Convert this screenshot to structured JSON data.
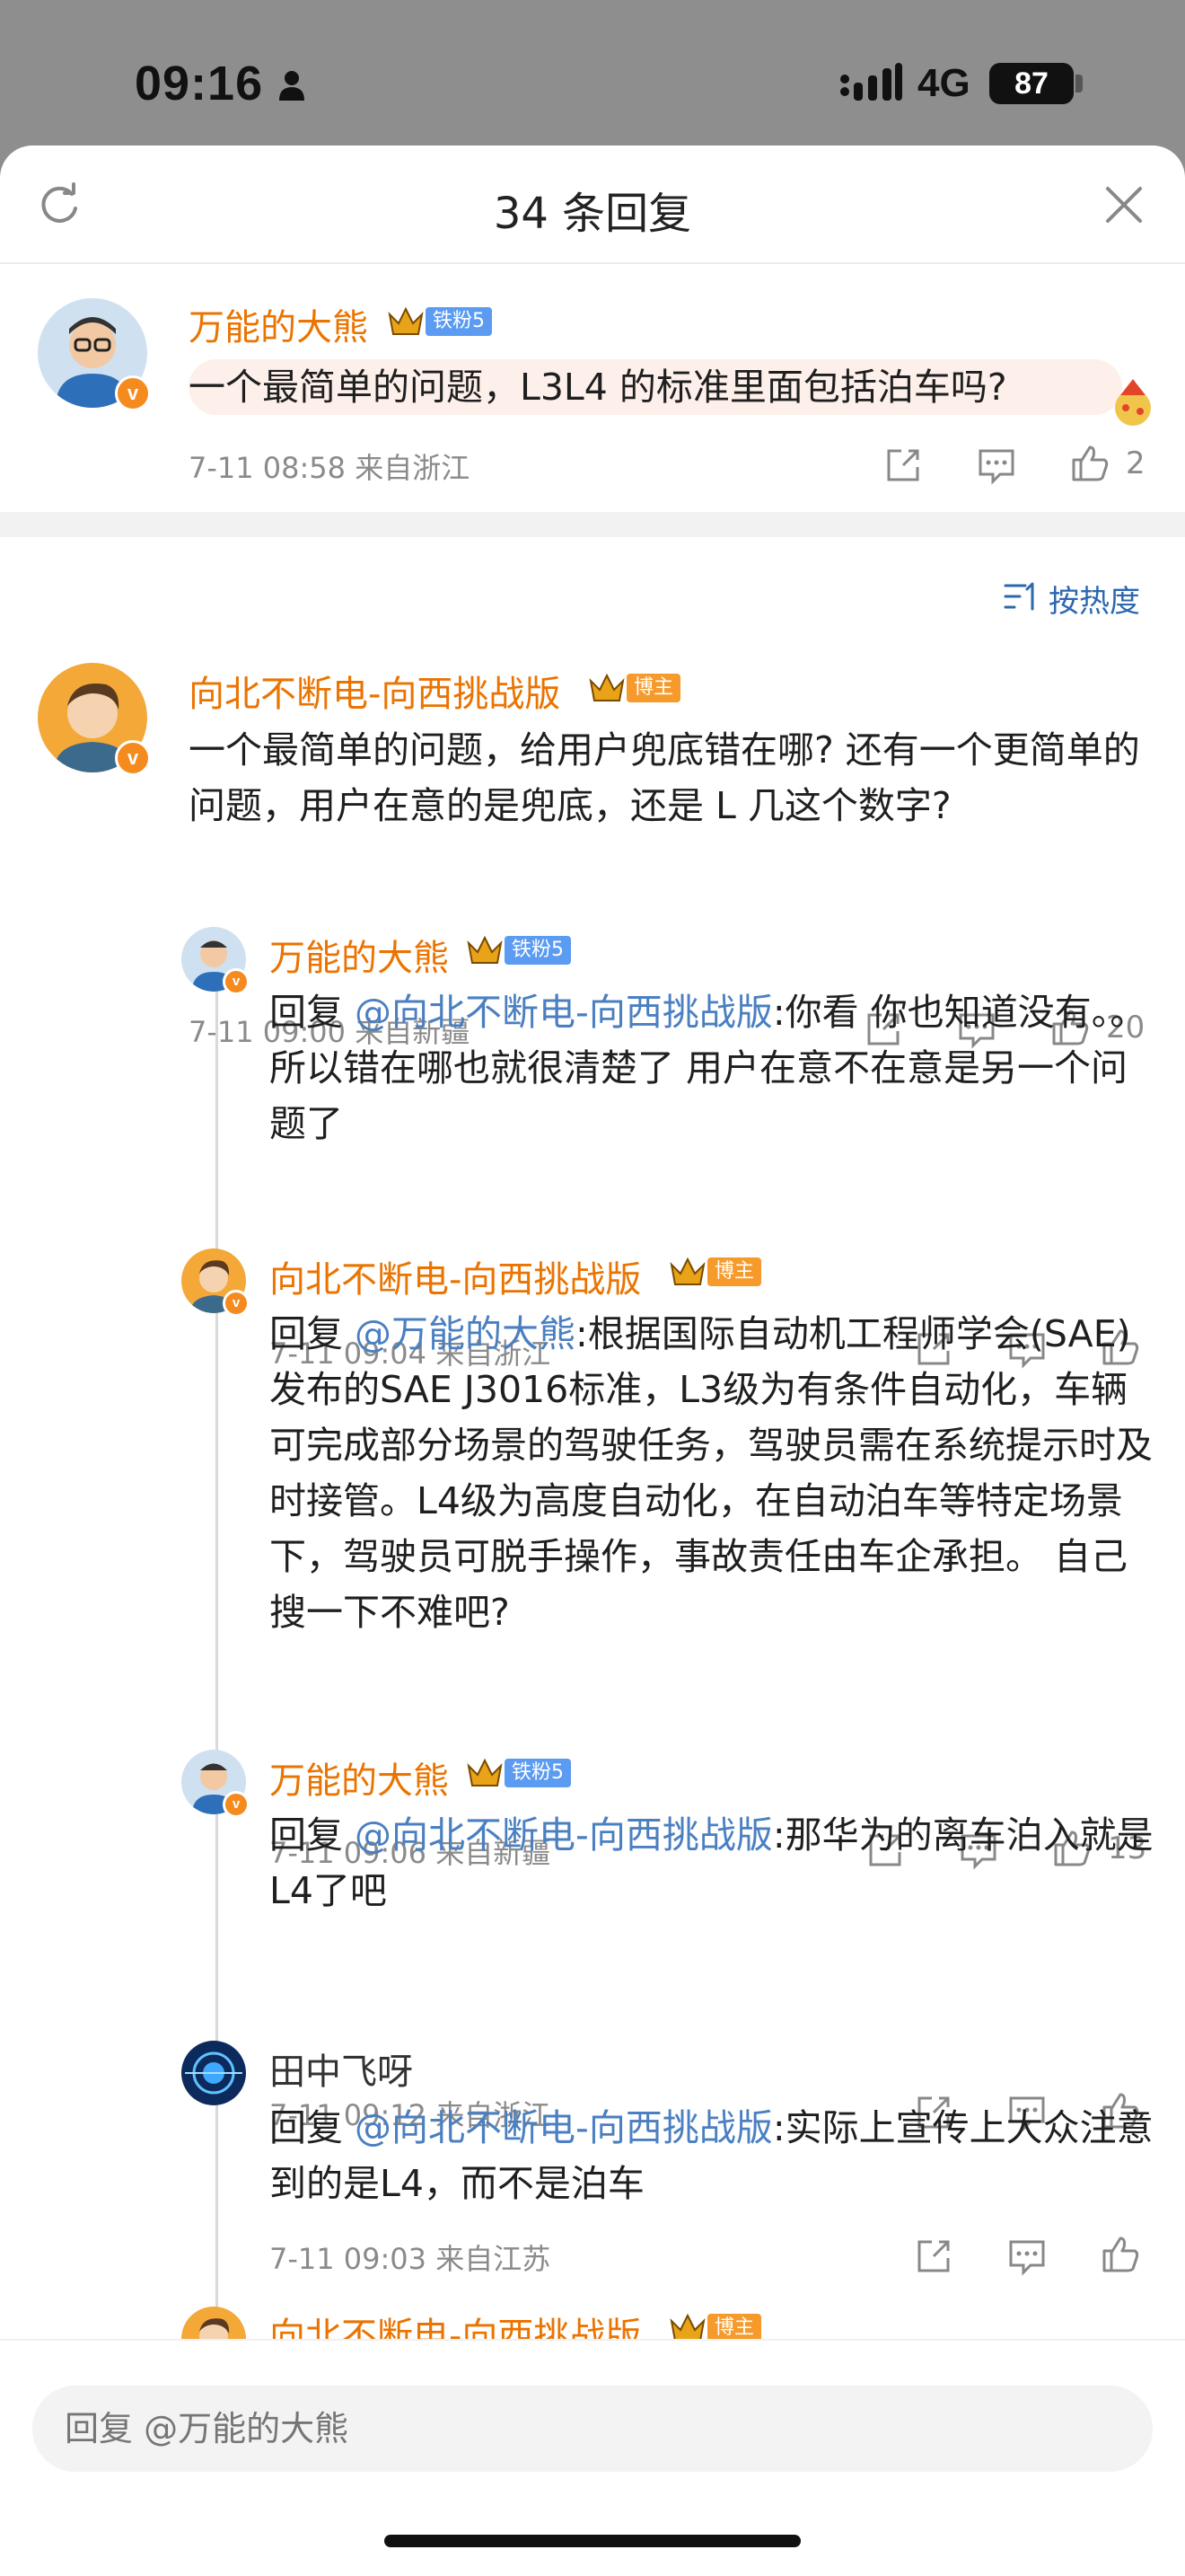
{
  "status_bar": {
    "time": "09:16",
    "network": "4G",
    "battery": "87"
  },
  "header": {
    "title": "34 条回复"
  },
  "sort": {
    "label": "按热度"
  },
  "main_comment": {
    "user": "万能的大熊",
    "tag": "铁粉5",
    "text": "一个最简单的问题，L3L4 的标准里面包括泊车吗?",
    "time": "7-11 08:58",
    "location": "来自浙江",
    "likes": "2"
  },
  "replies": [
    {
      "user": "向北不断电-向西挑战版",
      "tag": "博主",
      "text": "一个最简单的问题，给用户兜底错在哪? 还有一个更简单的问题，用户在意的是兜底，还是 L 几这个数字?",
      "time": "7-11 09:00",
      "location": "来自新疆",
      "likes": "20"
    },
    {
      "user": "万能的大熊",
      "tag": "铁粉5",
      "prefix": "回复",
      "mention": "@向北不断电-向西挑战版",
      "text": ":你看 你也知道没有。。所以错在哪也就很清楚了 用户在意不在意是另一个问题了",
      "time": "7-11 09:04",
      "location": "来自浙江",
      "likes": ""
    },
    {
      "user": "向北不断电-向西挑战版",
      "tag": "博主",
      "prefix": "回复",
      "mention": "@万能的大熊",
      "text": ":根据国际自动机工程师学会(SAE) 发布的SAE J3016标准，L3级为有条件自动化，车辆可完成部分场景的驾驶任务，驾驶员需在系统提示时及时接管。L4级为高度自动化，在自动泊车等特定场景下，驾驶员可脱手操作，事故责任由车企承担。 自己搜一下不难吧?",
      "time": "7-11 09:06",
      "location": "来自新疆",
      "likes": "13"
    },
    {
      "user": "万能的大熊",
      "tag": "铁粉5",
      "prefix": "回复",
      "mention": "@向北不断电-向西挑战版",
      "text": ":那华为的离车泊入就是L4了吧",
      "time": "7-11 09:12",
      "location": "来自浙江",
      "likes": ""
    },
    {
      "user": "田中飞呀",
      "tag": "",
      "prefix": "回复",
      "mention": "@向北不断电-向西挑战版",
      "text": ":实际上宣传上大众注意到的是L4，而不是泊车",
      "time": "7-11 09:03",
      "location": "来自江苏",
      "likes": ""
    },
    {
      "user": "向北不断电-向西挑战版",
      "tag": "博主"
    }
  ],
  "reply_box": {
    "placeholder": "回复 @万能的大熊"
  },
  "colors": {
    "username": "#eb7300",
    "mention": "#4a7fc1",
    "meta": "#8a8a8a",
    "fan_tag": "#5b9bf2",
    "host_tag": "#f59a2b"
  }
}
